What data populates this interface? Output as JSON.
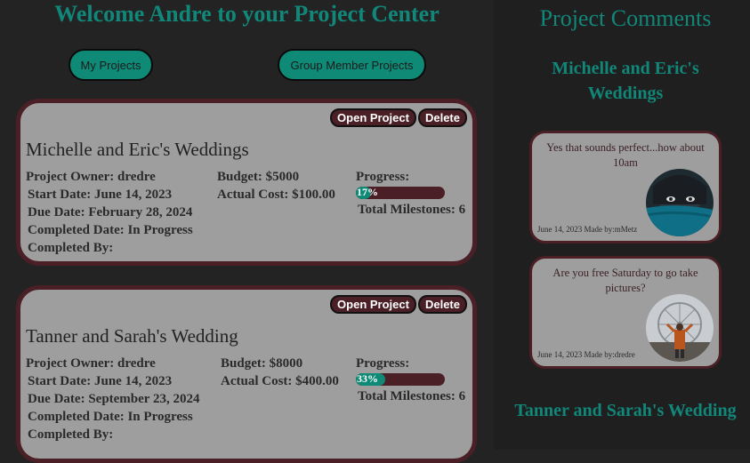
{
  "welcome_title": "Welcome Andre to your Project Center",
  "buttons": {
    "my_projects": "My Projects",
    "group_member_projects": "Group Member Projects"
  },
  "projects": [
    {
      "title": "Michelle and Eric's Weddings",
      "open_label": "Open Project",
      "delete_label": "Delete",
      "owner": "Project Owner: dredre",
      "start_date": "Start Date: June 14, 2023",
      "due_date": "Due Date: February 28, 2024",
      "completed_date": "Completed Date: In Progress",
      "completed_by": "Completed By:",
      "budget": "Budget: $5000",
      "actual_cost": "Actual Cost: $100.00",
      "progress_label": "Progress:",
      "progress_value": 17,
      "progress_text": "17%",
      "milestones": "Total Milestones: 6"
    },
    {
      "title": "Tanner and Sarah's Wedding",
      "open_label": "Open Project",
      "delete_label": "Delete",
      "owner": "Project Owner: dredre",
      "start_date": "Start Date: June 14, 2023",
      "due_date": "Due Date: September 23, 2024",
      "completed_date": "Completed Date: In Progress",
      "completed_by": "Completed By:",
      "budget": "Budget: $8000",
      "actual_cost": "Actual Cost: $400.00",
      "progress_label": "Progress:",
      "progress_value": 33,
      "progress_text": "33%",
      "milestones": "Total Milestones: 6"
    }
  ],
  "comments_panel": {
    "title": "Project Comments",
    "groups": [
      {
        "project": "Michelle and Eric's Weddings",
        "comments": [
          {
            "text": "Yes that sounds perfect...how about 10am",
            "meta": "June 14, 2023 Made by:mMetz",
            "avatar": "woman-face-avatar"
          },
          {
            "text": "Are you free Saturday to go take pictures?",
            "meta": "June 14, 2023 Made by:dredre",
            "avatar": "ferris-wheel-avatar"
          }
        ]
      },
      {
        "project": "Tanner and Sarah's Wedding",
        "comments": []
      }
    ]
  },
  "colors": {
    "background": "#232323",
    "accent": "#0e8a76",
    "card": "#9e9e9e",
    "card_border": "#4a1f26"
  }
}
